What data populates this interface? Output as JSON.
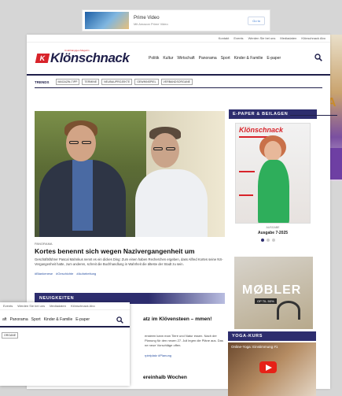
{
  "ad": {
    "title": "Prime Video",
    "subtitle": "Mit Amazon Prime Video",
    "button": "Go to"
  },
  "utility": [
    "Kontakt",
    "Events",
    "Werden Sie bei uns",
    "Mediadaten",
    "Klönschnack Abo"
  ],
  "logo": {
    "mark": "K",
    "text": "Klönschnack",
    "tagline": "Unabhängiges Magazin"
  },
  "nav": [
    "Politik",
    "Kultur",
    "Wirtschaft",
    "Panorama",
    "Sport",
    "Kinder & Familie",
    "E-paper"
  ],
  "trends": {
    "label": "TRENDS",
    "tags": [
      "MAGAZIN-TIPP",
      "TERMINE",
      "NEUBAUPROJEKTE",
      "GEWINNSPIEL",
      "VERBANDSORGANE"
    ]
  },
  "article": {
    "kicker": "PANORAMA",
    "title": "Kortes benennt sich wegen Nazivergangenheit um",
    "teaser": "Geschäftsführer Pascal Mahnkus nennt es ein dickes Ding: Zum einen haben Recherchen ergeben, dass Alfred Kortes seine NS-Vergangenheit hatte, zum anderen, schreit die Buchhandlung in Wahrheit die älteste der Stadt zu sein.",
    "tags": [
      "#Blankenese",
      "#Geschichte",
      "#Aufarbeitung"
    ]
  },
  "sections": {
    "news": "NEUIGKEITEN",
    "epaper": "E-PAPER & BEILAGEN",
    "yoga": "YOGA-KURS"
  },
  "epaper": {
    "cover_title": "Klönschnack",
    "label": "AUSGABE",
    "issue": "Ausgabe 7-2025"
  },
  "moebler": {
    "title": "MØBLER",
    "sub": "OP TIL 50%"
  },
  "yoga": {
    "video_title": "Online-Yoga: Einstimmung #1"
  },
  "news": [
    {
      "title": "atz im Klövensteen – mmen!",
      "text": "ensteen kann man Tiere und Natur essen. Nach der Planung für den neuen 27. Juli legen die Pläne aus. Das ne neue Vorschläge offen.",
      "tags": "rpielplatz  #Planung"
    },
    {
      "title": "ereinhalb Wochen"
    }
  ],
  "overlay": {
    "utility": [
      "Events",
      "Werden Sie bei uns",
      "Mediadaten",
      "Klönschnack Abo"
    ],
    "nav": [
      "aft",
      "Panorama",
      "Sport",
      "Kinder & Familie",
      "E-paper"
    ],
    "tag": "ORGANE"
  }
}
